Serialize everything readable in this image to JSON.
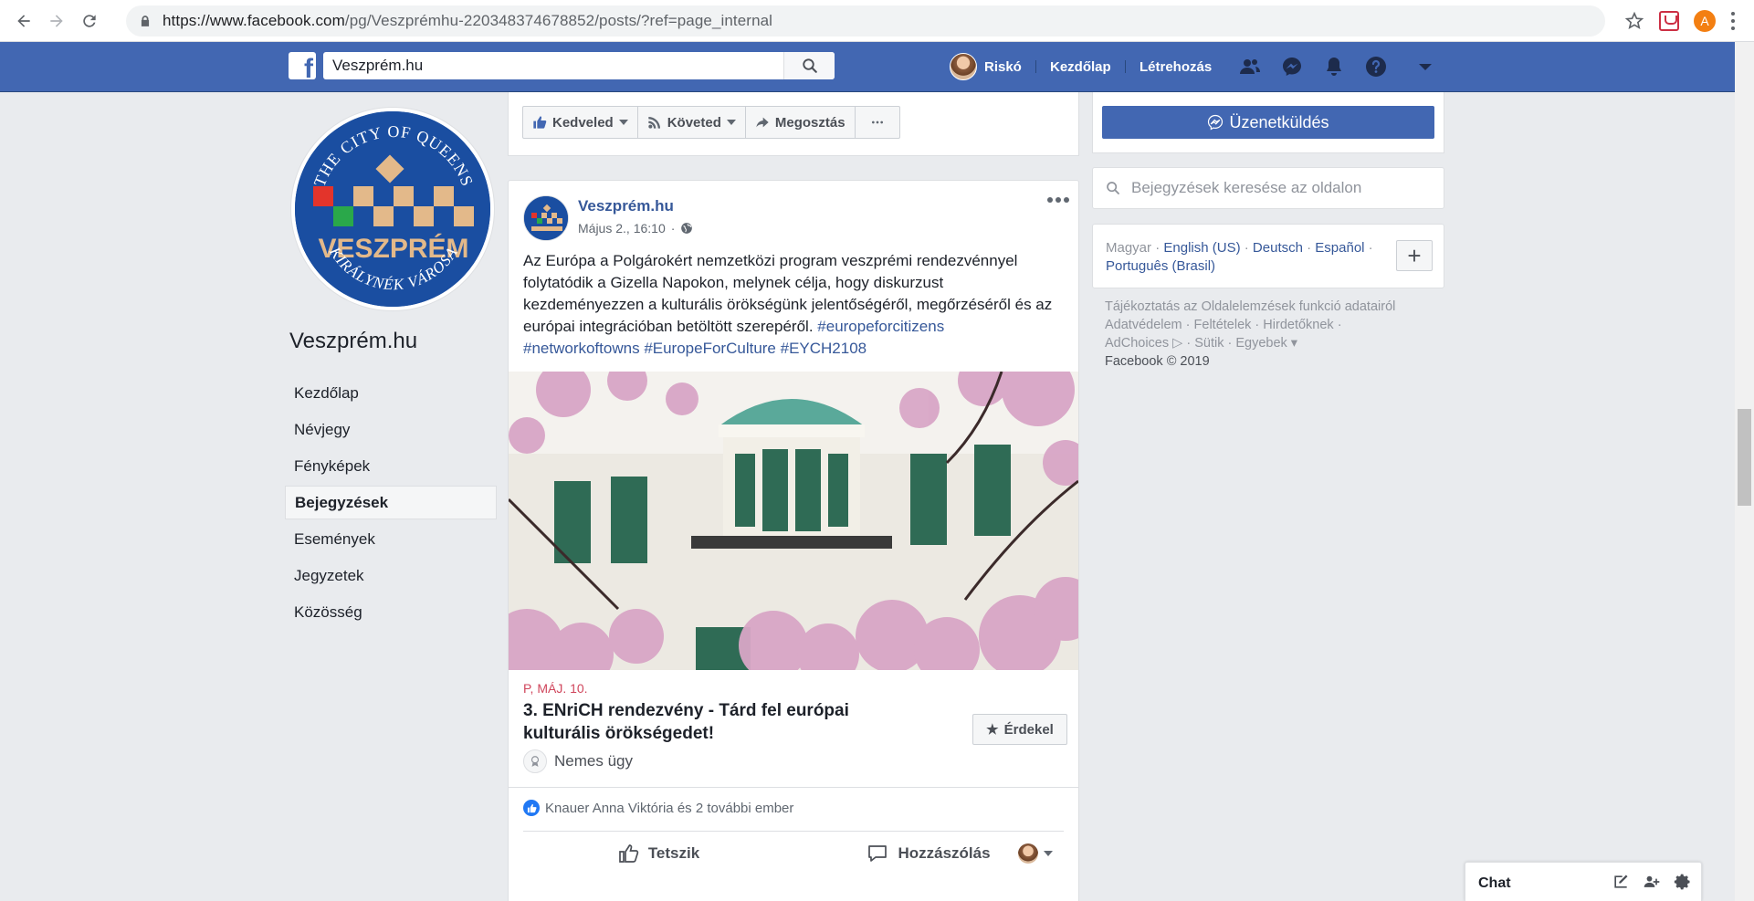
{
  "browser": {
    "url_prefix": "https://www.facebook.com",
    "url_path": "/pg/Veszprémhu-220348374678852/posts/?ref=page_internal",
    "profile_initial": "A"
  },
  "fb_header": {
    "search_value": "Veszprém.hu",
    "user_name": "Riskó",
    "home_label": "Kezdőlap",
    "create_label": "Létrehozás"
  },
  "page": {
    "name": "Veszprém.hu",
    "logo_top_text": "THE CITY OF QUEENS",
    "logo_main_text": "VESZPRÉM",
    "logo_bottom_text": "KIRÁLYNÉK VÁROSA",
    "nav": [
      {
        "label": "Kezdőlap",
        "active": false
      },
      {
        "label": "Névjegy",
        "active": false
      },
      {
        "label": "Fényképek",
        "active": false
      },
      {
        "label": "Bejegyzések",
        "active": true
      },
      {
        "label": "Események",
        "active": false
      },
      {
        "label": "Jegyzetek",
        "active": false
      },
      {
        "label": "Közösség",
        "active": false
      }
    ]
  },
  "page_actions": {
    "like": "Kedveled",
    "follow": "Követed",
    "share": "Megosztás",
    "message": "Üzenetküldés"
  },
  "post": {
    "author": "Veszprém.hu",
    "time": "Május 2., 16:10",
    "text": "Az Európa a Polgárokért nemzetközi program veszprémi rendezvénnyel folytatódik a Gizella Napokon, melynek célja, hogy diskurzust kezdeményezzen a kulturális örökségünk jelentőségéről, megőrzéséről és az európai integrációban betöltött szerepéről.",
    "hashtags": [
      "#europeforcitizens",
      "#networkoftowns",
      "#EuropeForCulture",
      "#EYCH2108"
    ],
    "event_date": "P, MÁJ. 10.",
    "event_title": "3. ENriCH rendezvény - Tárd fel európai kulturális örökségedet!",
    "interested_label": "Érdekel",
    "cause": "Nemes ügy",
    "likes_text": "Knauer Anna Viktória és 2 további ember",
    "like_action": "Tetszik",
    "comment_action": "Hozzászólás"
  },
  "sidebar": {
    "search_placeholder": "Bejegyzések keresése az oldalon",
    "languages_current": "Magyar",
    "languages": [
      "English (US)",
      "Deutsch",
      "Español",
      "Português (Brasil)"
    ],
    "footer": {
      "line1": "Tájékoztatás az Oldalelemzések funkció adatairól",
      "line2a": "Adatvédelem",
      "line2b": "Feltételek",
      "line2c": "Hirdetőknek",
      "line3a": "AdChoices",
      "line3b": "Sütik",
      "line3c": "Egyebek",
      "copyright": "Facebook © 2019"
    }
  },
  "chat": {
    "label": "Chat"
  },
  "colors": {
    "fb_blue": "#4267b2",
    "link": "#365899",
    "event_red": "#d0465c"
  }
}
